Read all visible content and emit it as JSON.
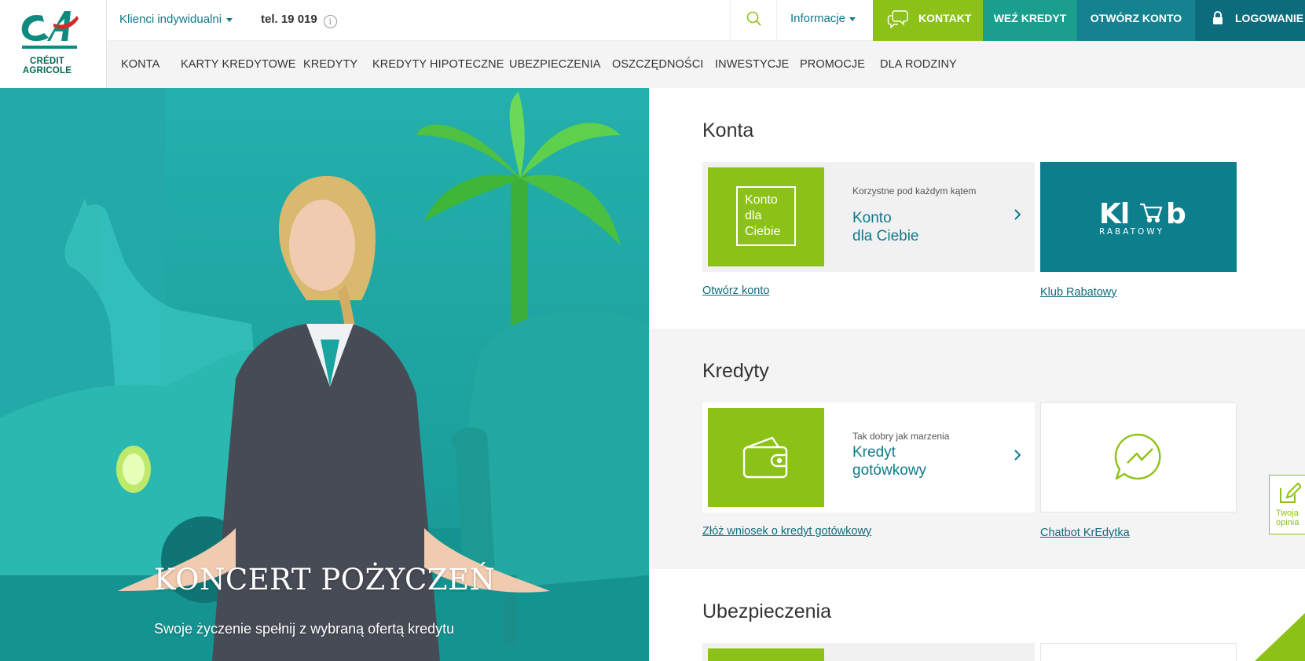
{
  "brand": {
    "line1": "CRÉDIT",
    "line2": "AGRICOLE"
  },
  "topbar": {
    "segment": "Klienci indywidualni",
    "phone": "tel. 19 019",
    "info_menu": "Informacje",
    "buttons": {
      "contact": "KONTAKT",
      "loan": "WEŹ KREDYT",
      "open_account": "OTWÓRZ KONTO",
      "login": "LOGOWANIE"
    }
  },
  "nav": [
    "KONTA",
    "KARTY KREDYTOWE",
    "KREDYTY",
    "KREDYTY HIPOTECZNE",
    "UBEZPIECZENIA",
    "OSZCZĘDNOŚCI",
    "INWESTYCJE",
    "PROMOCJE",
    "DLA RODZINY"
  ],
  "hero": {
    "title": "KONCERT POŻYCZEŃ",
    "subtitle": "Swoje życzenie spełnij z wybraną ofertą kredytu"
  },
  "sections": {
    "konta": {
      "title": "Konta",
      "tile_text": [
        "Konto",
        "dla",
        "Ciebie"
      ],
      "kicker": "Korzystne pod każdym kątem",
      "name_line1": "Konto",
      "name_line2": "dla Ciebie",
      "link": "Otwórz konto",
      "side_tile_title": "Klub",
      "side_tile_sub": "RABATOWY",
      "side_link": "Klub Rabatowy"
    },
    "kredyty": {
      "title": "Kredyty",
      "kicker": "Tak dobry jak marzenia",
      "name_line1": "Kredyt",
      "name_line2": "gotówkowy",
      "link": "Złóż wniosek o kredyt gotówkowy",
      "side_link": "Chatbot KrEdytka"
    },
    "ubezpieczenia": {
      "title": "Ubezpieczenia"
    }
  },
  "feedback": {
    "line1": "Twoja",
    "line2": "opinia"
  },
  "colors": {
    "green": "#8cc217",
    "teal": "#0f7a8a",
    "teal_dark": "#0d6c7b",
    "teal_mid": "#1a9e8d"
  }
}
